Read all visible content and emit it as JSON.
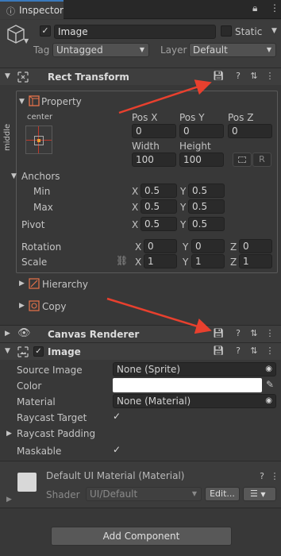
{
  "tab": {
    "title": "Inspector"
  },
  "object": {
    "name": "Image",
    "static_label": "Static",
    "tag_label": "Tag",
    "tag_value": "Untagged",
    "layer_label": "Layer",
    "layer_value": "Default"
  },
  "rect_transform": {
    "title": "Rect Transform",
    "property_label": "Property",
    "anchor_h": "center",
    "anchor_v": "middle",
    "pos_x_label": "Pos X",
    "pos_y_label": "Pos Y",
    "pos_z_label": "Pos Z",
    "pos_x": "0",
    "pos_y": "0",
    "pos_z": "0",
    "width_label": "Width",
    "height_label": "Height",
    "width": "100",
    "height": "100",
    "r_label": "R",
    "anchors_label": "Anchors",
    "min_label": "Min",
    "max_label": "Max",
    "min_x": "0.5",
    "min_y": "0.5",
    "max_x": "0.5",
    "max_y": "0.5",
    "pivot_label": "Pivot",
    "pivot_x": "0.5",
    "pivot_y": "0.5",
    "rotation_label": "Rotation",
    "rot_x": "0",
    "rot_y": "0",
    "rot_z": "0",
    "scale_label": "Scale",
    "scale_x": "1",
    "scale_y": "1",
    "scale_z": "1",
    "x": "X",
    "y": "Y",
    "z": "Z",
    "hierarchy_label": "Hierarchy",
    "copy_label": "Copy"
  },
  "canvas_renderer": {
    "title": "Canvas Renderer"
  },
  "image": {
    "title": "Image",
    "source_image_label": "Source Image",
    "source_image_value": "None (Sprite)",
    "color_label": "Color",
    "color_value": "#ffffff",
    "material_label": "Material",
    "material_value": "None (Material)",
    "raycast_target_label": "Raycast Target",
    "raycast_padding_label": "Raycast Padding",
    "maskable_label": "Maskable"
  },
  "material": {
    "name": "Default UI Material (Material)",
    "shader_label": "Shader",
    "shader_value": "UI/Default",
    "edit_label": "Edit..."
  },
  "add_component": "Add Component",
  "colors": {
    "arrow": "#e8402e",
    "panel": "#383838",
    "header": "#3e3e3e"
  }
}
